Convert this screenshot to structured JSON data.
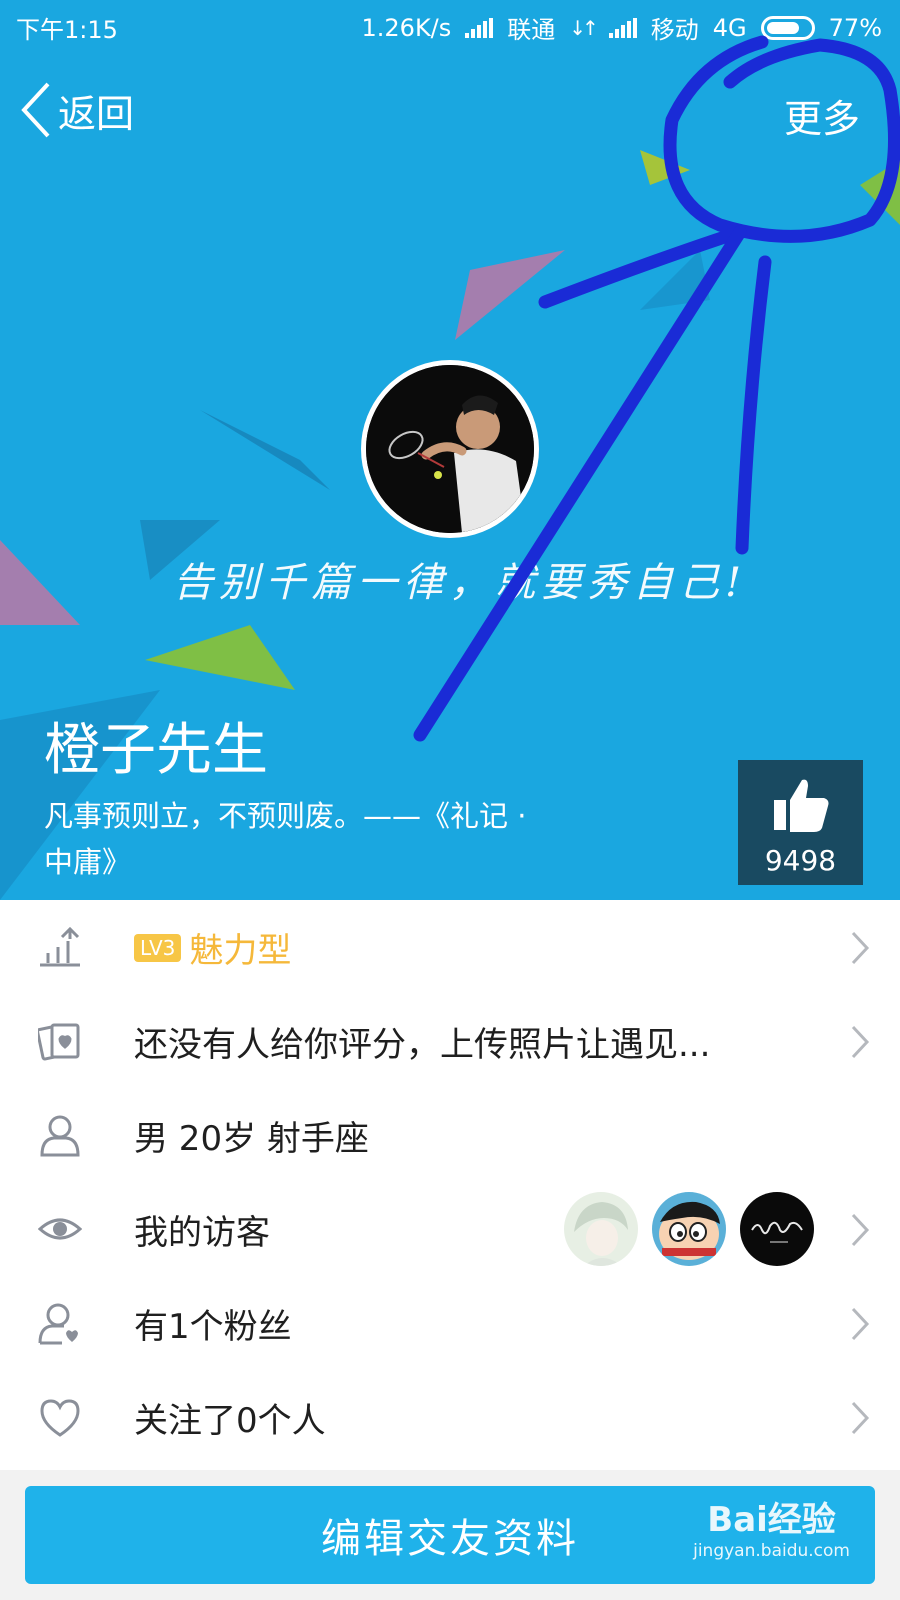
{
  "status_bar": {
    "time": "下午1:15",
    "speed": "1.26K/s",
    "carrier1": "联通",
    "carrier2": "移动",
    "network": "4G",
    "battery": "77%"
  },
  "nav": {
    "back_label": "返回",
    "more_label": "更多"
  },
  "profile": {
    "slogan": "告别千篇一律，就要秀自己!",
    "nickname": "橙子先生",
    "bio": "凡事预则立，不预则废。——《礼记 · 中庸》",
    "like_count": "9498"
  },
  "rows": {
    "level": {
      "badge": "LV3",
      "type": "魅力型",
      "icon": "level-chart-icon"
    },
    "rating": {
      "text": "还没有人给你评分，上传照片让遇见...",
      "icon": "photo-cards-icon"
    },
    "info": {
      "text": "男 20岁 射手座",
      "icon": "person-icon"
    },
    "visitors": {
      "text": "我的访客",
      "icon": "eye-icon"
    },
    "fans": {
      "text": "有1个粉丝",
      "icon": "person-heart-icon"
    },
    "following": {
      "text": "关注了0个人",
      "icon": "heart-icon"
    }
  },
  "footer": {
    "edit_button": "编辑交友资料",
    "watermark_brand": "Bai经验",
    "watermark_url": "jingyan.baidu.com"
  },
  "colors": {
    "hero_bg": "#1aa7e0",
    "like_box": "#194a61",
    "level_badge": "#f7c646",
    "edit_button": "#1fb2ea",
    "annotation_ink": "#1a2bd6"
  }
}
